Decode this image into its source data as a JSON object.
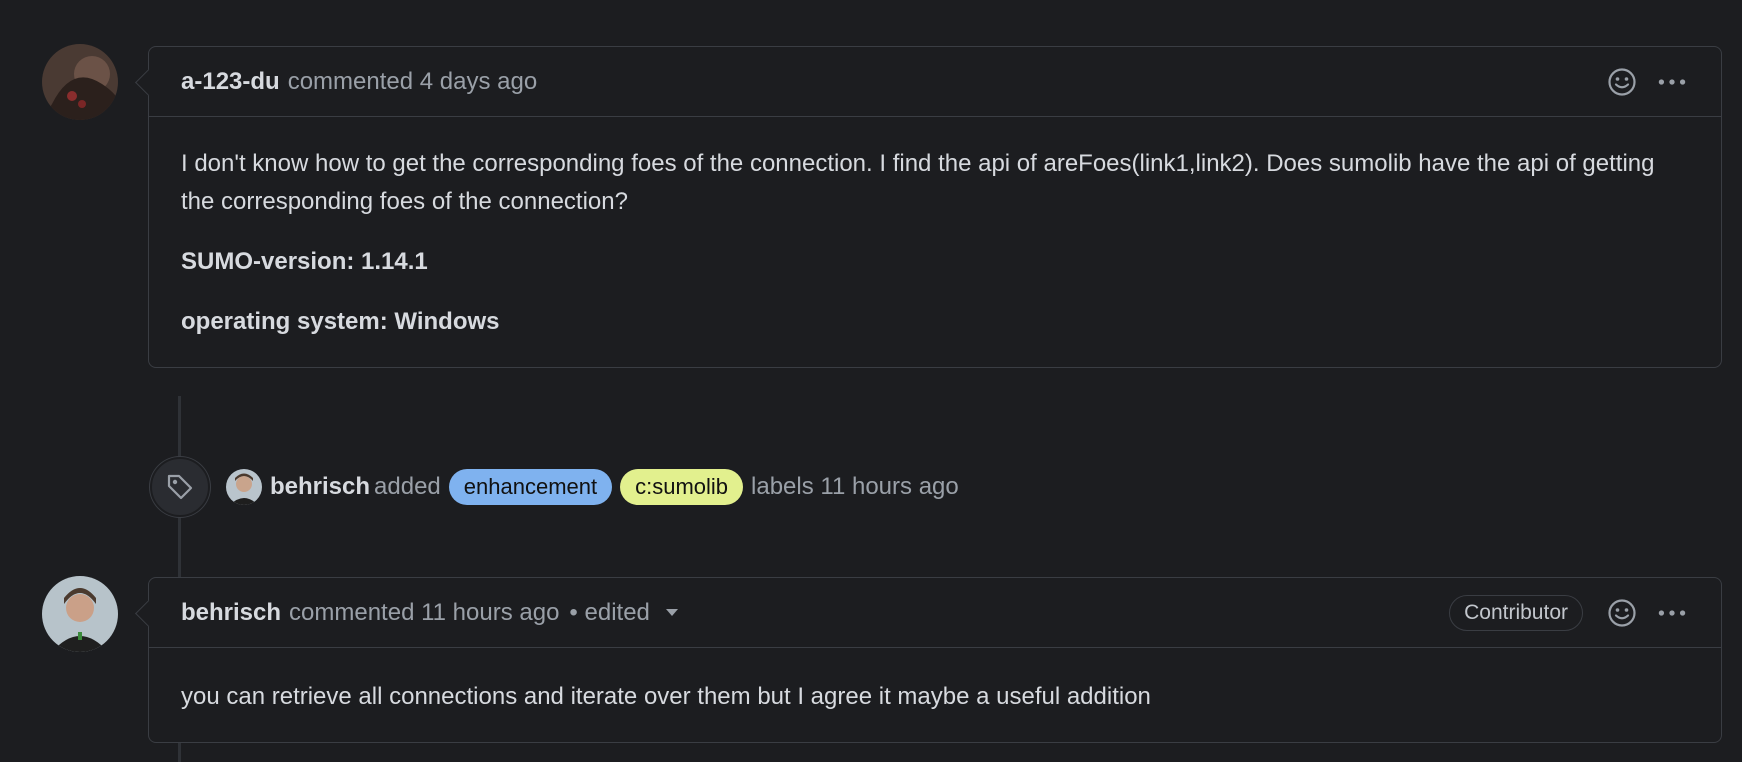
{
  "comments": [
    {
      "author": "a-123-du",
      "action": "commented 4 days ago",
      "body": {
        "paragraph": "I don't know how to get the corresponding foes of the connection. I find the api of areFoes(link1,link2). Does sumolib have the api of getting the corresponding foes of the connection?",
        "version": "SUMO-version: 1.14.1",
        "os": "operating system: Windows"
      }
    },
    {
      "author": "behrisch",
      "action": "commented 11 hours ago",
      "edited": "• edited",
      "badge": "Contributor",
      "body": {
        "paragraph": "you can retrieve all connections and iterate over them but I agree it maybe a useful addition"
      }
    }
  ],
  "event": {
    "actor": "behrisch",
    "verb": "added",
    "labels": [
      {
        "name": "enhancement",
        "color": "#7fb2ef"
      },
      {
        "name": "c:sumolib",
        "color": "#e2f08e"
      }
    ],
    "suffix": "labels 11 hours ago"
  },
  "icons": {
    "reaction": "smiley-icon",
    "menu": "kebab-icon",
    "event": "tag-icon"
  }
}
